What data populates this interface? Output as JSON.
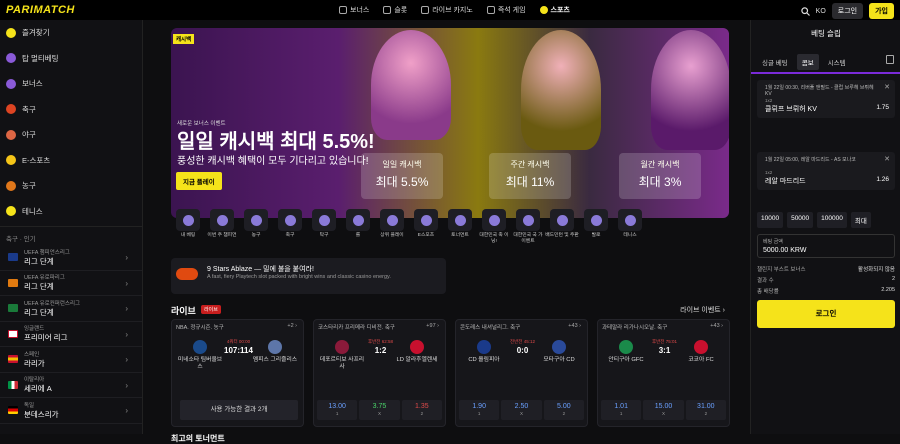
{
  "header": {
    "logo": "PARIMATCH",
    "nav": [
      {
        "label": "보너스",
        "icon": "gift-icon"
      },
      {
        "label": "슬롯",
        "icon": "slot-icon"
      },
      {
        "label": "라이브 카지노",
        "icon": "cards-icon"
      },
      {
        "label": "즉석 게임",
        "icon": "bolt-icon"
      },
      {
        "label": "스포츠",
        "icon": "ball-icon"
      }
    ],
    "lang": "KO",
    "login": "로그인",
    "join": "가입"
  },
  "sidebar": {
    "items": [
      {
        "label": "즐겨찾기",
        "color": "#f5e31a"
      },
      {
        "label": "탑 멀티베팅",
        "color": "#8a5ad8"
      },
      {
        "label": "보너스",
        "color": "#8a5ad8"
      },
      {
        "label": "축구",
        "color": "#dd4422"
      },
      {
        "label": "야구",
        "color": "#dd6644"
      },
      {
        "label": "E-스포츠",
        "color": "#f5c518"
      },
      {
        "label": "농구",
        "color": "#e0771a"
      },
      {
        "label": "테니스",
        "color": "#f5e31a"
      }
    ],
    "section": "축구 · 인기",
    "leagues": [
      {
        "top": "UEFA 챔피언스리그",
        "name": "리그 단계",
        "color": "#1a3a8a"
      },
      {
        "top": "UEFA 유로파리그",
        "name": "리그 단계",
        "color": "#e07a10"
      },
      {
        "top": "UEFA 유로컨퍼런스리그",
        "name": "리그 단계",
        "color": "#1a7a3a"
      },
      {
        "top": "잉글랜드",
        "name": "프리미어 리그",
        "color": "#ffffff"
      },
      {
        "top": "스페인",
        "name": "라리가",
        "color": "#c8102e"
      },
      {
        "top": "이탈리아",
        "name": "세리에 A",
        "color": "#009246"
      },
      {
        "top": "독일",
        "name": "분데스리가",
        "color": "#dd0000"
      }
    ]
  },
  "banner": {
    "tag": "캐시백",
    "sub1": "새로운 보너스 이벤트",
    "title": "일일 캐시백 최대 5.5%!",
    "subtitle": "풍성한 캐시백 혜택이 모두 기다리고 있습니다!",
    "cta": "지금 플레이",
    "promos": [
      {
        "label": "일일 캐시백",
        "value": "최대 5.5%"
      },
      {
        "label": "주간 캐시백",
        "value": "최대 11%"
      },
      {
        "label": "월간 캐시백",
        "value": "최대 3%"
      }
    ]
  },
  "sports": [
    "내 베팅",
    "이번 주 챔피언",
    "농구",
    "축구",
    "탁구",
    "롤",
    "상위 플레이",
    "E스포츠",
    "토너먼트",
    "대한민국 축 이닝!",
    "대한민국 국 가 이벤트",
    "배드민턴 및 주판",
    "발로",
    "테니스"
  ],
  "promo_card": {
    "title": "9 Stars Ablaze — 밀에 불을 붙여라!",
    "desc": "A fast, fiery Playtech slot packed with bright wins and classic casino energy."
  },
  "live": {
    "title": "라이브",
    "badge": "라이브",
    "events_link": "라이브 이벤트 ›",
    "matches": [
      {
        "league": "NBA. 정규시즌. 농구",
        "count": "+2 ›",
        "team1": "미네소타 팀버울브스",
        "team2": "멤피스 그리즐리스",
        "score": "107:114",
        "status": "4쿼터 00:00",
        "c1": "#1a4a8a",
        "c2": "#5d76a9",
        "offline": "사용 가능한 결과 2개"
      },
      {
        "league": "코스타리카 프리메라 디비전. 축구",
        "count": "+97 ›",
        "team1": "데포르티보 사프리사",
        "team2": "LD 알라후엘렌세",
        "score": "1:2",
        "status": "후반전 62:58",
        "c1": "#8a1a3a",
        "c2": "#c8102e",
        "odds": [
          {
            "v": "13.00",
            "l": "1"
          },
          {
            "v": "3.75",
            "l": "X"
          },
          {
            "v": "1.35",
            "l": "2"
          }
        ]
      },
      {
        "league": "콘도레스 내셔널리그. 축구",
        "count": "+43 ›",
        "team1": "CD 올림피아",
        "team2": "모타구아 CD",
        "score": "0:0",
        "status": "전반전 45:12",
        "c1": "#1a3a8a",
        "c2": "#2a4a9a",
        "odds": [
          {
            "v": "1.90",
            "l": "1"
          },
          {
            "v": "2.50",
            "l": "X"
          },
          {
            "v": "5.00",
            "l": "2"
          }
        ]
      },
      {
        "league": "과테말라 리가나시오날. 축구",
        "count": "+43 ›",
        "team1": "안티구아 GFC",
        "team2": "코코아 FC",
        "score": "3:1",
        "status": "후반전 75:01",
        "c1": "#1a8a4a",
        "c2": "#c8102e",
        "odds": [
          {
            "v": "1.01",
            "l": "1"
          },
          {
            "v": "15.00",
            "l": "X"
          },
          {
            "v": "31.00",
            "l": "2"
          }
        ]
      }
    ]
  },
  "tournaments_title": "최고의 토너먼트",
  "betslip": {
    "title": "베팅 슬립",
    "tabs": [
      "싱글 베팅",
      "콤보",
      "시스템"
    ],
    "active_tab": 1,
    "bets": [
      {
        "match": "1월 22일 00:30, 리버풀 앤필드 - 클럽 브루헤 브뤼헤 KV",
        "kind": "1x2",
        "pick": "클뤼프 브뤼허 KV",
        "odds": "1.75"
      },
      {
        "match": "1월 22일 05:00, 레알 마드리드 - AS 모나코",
        "kind": "1x2",
        "pick": "레알 마드리드",
        "odds": "1.26"
      }
    ],
    "stakes": [
      "10000",
      "50000",
      "100000",
      "최대"
    ],
    "stake_label": "베팅 금액",
    "stake_value": "5000.00 KRW",
    "rows": [
      {
        "k": "챌린지 부스트 보너스",
        "v": "활성화되지 않음"
      },
      {
        "k": "결과 수",
        "v": "2"
      },
      {
        "k": "총 배당률",
        "v": "2.205"
      }
    ],
    "login": "로그인"
  }
}
